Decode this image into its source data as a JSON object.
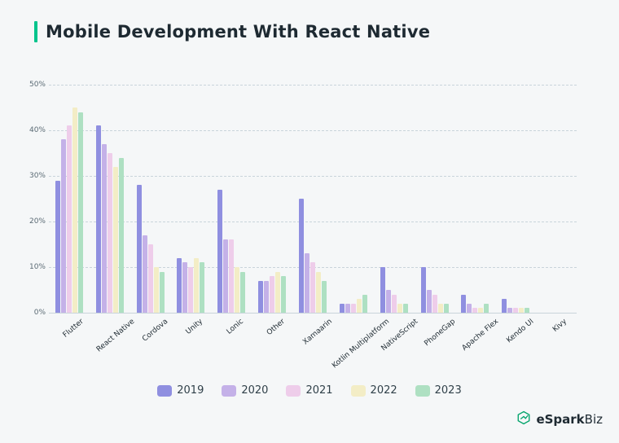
{
  "title": "Mobile Development With React Native",
  "y_ticks": [
    "0%",
    "10%",
    "20%",
    "30%",
    "40%",
    "50%"
  ],
  "legend": [
    {
      "name": "2019",
      "cls": "c2019"
    },
    {
      "name": "2020",
      "cls": "c2020"
    },
    {
      "name": "2021",
      "cls": "c2021"
    },
    {
      "name": "2022",
      "cls": "c2022"
    },
    {
      "name": "2023",
      "cls": "c2023"
    }
  ],
  "logo": {
    "brand": "eSpark",
    "suffix": "Biz"
  },
  "chart_data": {
    "type": "bar",
    "title": "Mobile Development With React Native",
    "ylabel": "",
    "xlabel": "",
    "ylim": [
      0,
      50
    ],
    "categories": [
      "Flutter",
      "React Native",
      "Cordova",
      "Unity",
      "Lonic",
      "Other",
      "Xamaarin",
      "Kotlin Multiplatform",
      "NativeScript",
      "PhoneGap",
      "Apache Flex",
      "Kendo UI",
      "Kivy"
    ],
    "series": [
      {
        "name": "2019",
        "values": [
          29,
          41,
          28,
          12,
          27,
          7,
          25,
          2,
          10,
          10,
          4,
          3,
          0
        ]
      },
      {
        "name": "2020",
        "values": [
          38,
          37,
          17,
          11,
          16,
          7,
          13,
          2,
          5,
          5,
          2,
          1,
          0
        ]
      },
      {
        "name": "2021",
        "values": [
          41,
          35,
          15,
          10,
          16,
          8,
          11,
          2,
          4,
          4,
          1,
          1,
          0
        ]
      },
      {
        "name": "2022",
        "values": [
          45,
          32,
          10,
          12,
          10,
          9,
          9,
          3,
          2,
          2,
          1,
          1,
          0
        ]
      },
      {
        "name": "2023",
        "values": [
          44,
          34,
          9,
          11,
          9,
          8,
          7,
          4,
          2,
          2,
          2,
          1,
          0
        ]
      }
    ]
  }
}
